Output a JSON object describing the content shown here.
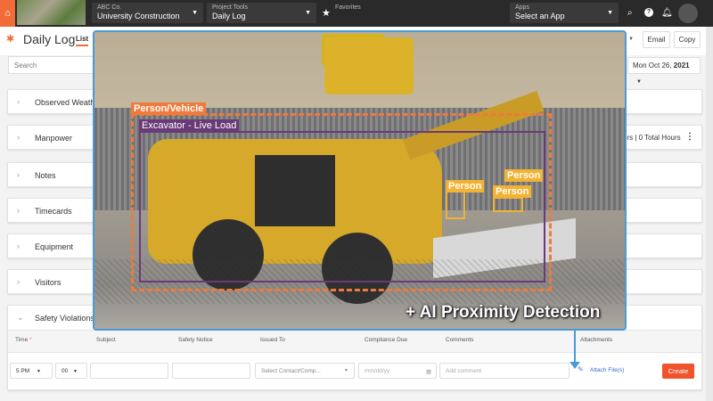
{
  "topbar": {
    "company": "ABC Co.",
    "project": "University Construction",
    "tools_label": "Project Tools",
    "tools_value": "Daily Log",
    "favorites_label": "Favorites",
    "apps_label": "Apps",
    "apps_value": "Select an App"
  },
  "header": {
    "title": "Daily Log",
    "tab_list": "List",
    "email": "Email",
    "copy": "Copy"
  },
  "search": {
    "placeholder": "Search",
    "date_prefix": "Mon Oct 26, ",
    "date_year": "2021"
  },
  "sections": [
    {
      "label": "Observed Weather"
    },
    {
      "label": "Manpower",
      "summary": "ers | 0 Total Hours"
    },
    {
      "label": "Notes"
    },
    {
      "label": "Timecards"
    },
    {
      "label": "Equipment"
    },
    {
      "label": "Visitors"
    },
    {
      "label": "Safety Violations"
    }
  ],
  "table": {
    "headers": [
      "Time",
      "Subject",
      "Safety Notice",
      "Issued To",
      "Compliance Due",
      "Comments",
      "Attachments"
    ],
    "required_mark": "*",
    "row": {
      "hour": "5 PM",
      "minute": "00",
      "issued_placeholder": "Select Contact/Comp...",
      "date_placeholder": "mm/dd/yy",
      "comment_placeholder": "Add comment",
      "attach": "Attach File(s)",
      "create": "Create"
    }
  },
  "overlay": {
    "caption": "+ AI Proximity Detection",
    "labels": {
      "zone": "Person/Vehicle",
      "excavator": "Excavator - Live Load",
      "person": "Person"
    }
  },
  "colors": {
    "accent": "#f26c3a",
    "zone": "#f07a3c",
    "excavator": "#6a3a78",
    "person": "#f2b233",
    "frame": "#4a9ad8"
  }
}
